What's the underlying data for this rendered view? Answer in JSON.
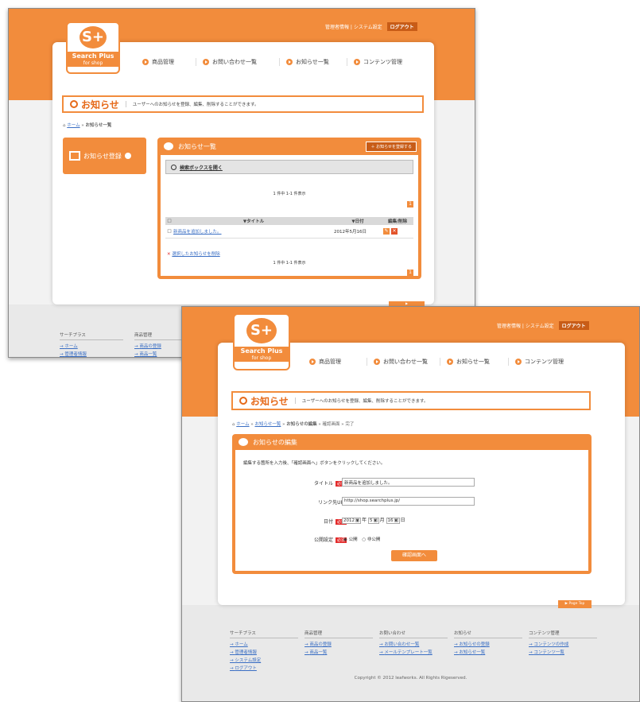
{
  "brand": {
    "name": "Search Plus",
    "sub": "for shop"
  },
  "toplinks": {
    "account": "管理者情報",
    "system": "システム設定",
    "logout": "ログアウト"
  },
  "nav": [
    "商品管理",
    "お問い合わせ一覧",
    "お知らせ一覧",
    "コンテンツ管理"
  ],
  "page_title": "お知らせ",
  "page_desc": "ユーザーへのお知らせを登録、編集、削除することができます。",
  "screen1": {
    "breadcrumb": [
      "ホーム",
      "お知らせ一覧"
    ],
    "register_button": "お知らせ登録",
    "list_title": "お知らせ一覧",
    "add_button": "お知らせを登録する",
    "search_toggle": "検索ボックスを開く",
    "count": "1 件中 1-1 件表示",
    "columns": [
      "▼タイトル",
      "▼日付",
      "編集/削除"
    ],
    "rows": [
      {
        "title": "新商品を追加しました。",
        "date": "2012年5月16日"
      }
    ],
    "delete_selected": "選択したお知らせを削除",
    "page_number": "1",
    "footer": [
      {
        "heading": "サーチプラス",
        "links": [
          "ホーム",
          "管理者情報"
        ]
      },
      {
        "heading": "商品管理",
        "links": [
          "商品の登録",
          "商品一覧"
        ]
      }
    ]
  },
  "screen2": {
    "breadcrumb": [
      "ホーム",
      "お知らせ一覧",
      "お知らせの編集",
      "確認画面",
      "完了"
    ],
    "panel_title": "お知らせの編集",
    "instruction": "編集する箇所を入力後、「確認画面へ」ボタンをクリックしてください。",
    "required_label": "必須",
    "fields": {
      "title_label": "タイトル",
      "title_value": "新商品を追加しました。",
      "url_label": "リンク先URL",
      "url_value": "http://shop.searchplus.jp/",
      "date_label": "日付",
      "year": "2012",
      "year_unit": "年",
      "month": "5",
      "month_unit": "月",
      "day": "16",
      "day_unit": "日",
      "status_label": "公開設定",
      "opt_public": "公開",
      "opt_private": "非公開"
    },
    "confirm_button": "確認画面へ",
    "page_top": "Page Top",
    "footer": [
      {
        "heading": "サーチプラス",
        "links": [
          "ホーム",
          "管理者情報",
          "システム設定",
          "ログアウト"
        ]
      },
      {
        "heading": "商品管理",
        "links": [
          "商品の登録",
          "商品一覧"
        ]
      },
      {
        "heading": "お問い合わせ",
        "links": [
          "お問い合わせ一覧",
          "メールテンプレート一覧"
        ]
      },
      {
        "heading": "お知らせ",
        "links": [
          "お知らせの登録",
          "お知らせ一覧"
        ]
      },
      {
        "heading": "コンテンツ管理",
        "links": [
          "コンテンツの作成",
          "コンテンツ一覧"
        ]
      }
    ],
    "copyright": "Copyright © 2012 leafworks. All Rights Rigeserved."
  },
  "colors": {
    "accent": "#f28c3c",
    "required": "#e32b2b",
    "link": "#3b6fc4"
  }
}
